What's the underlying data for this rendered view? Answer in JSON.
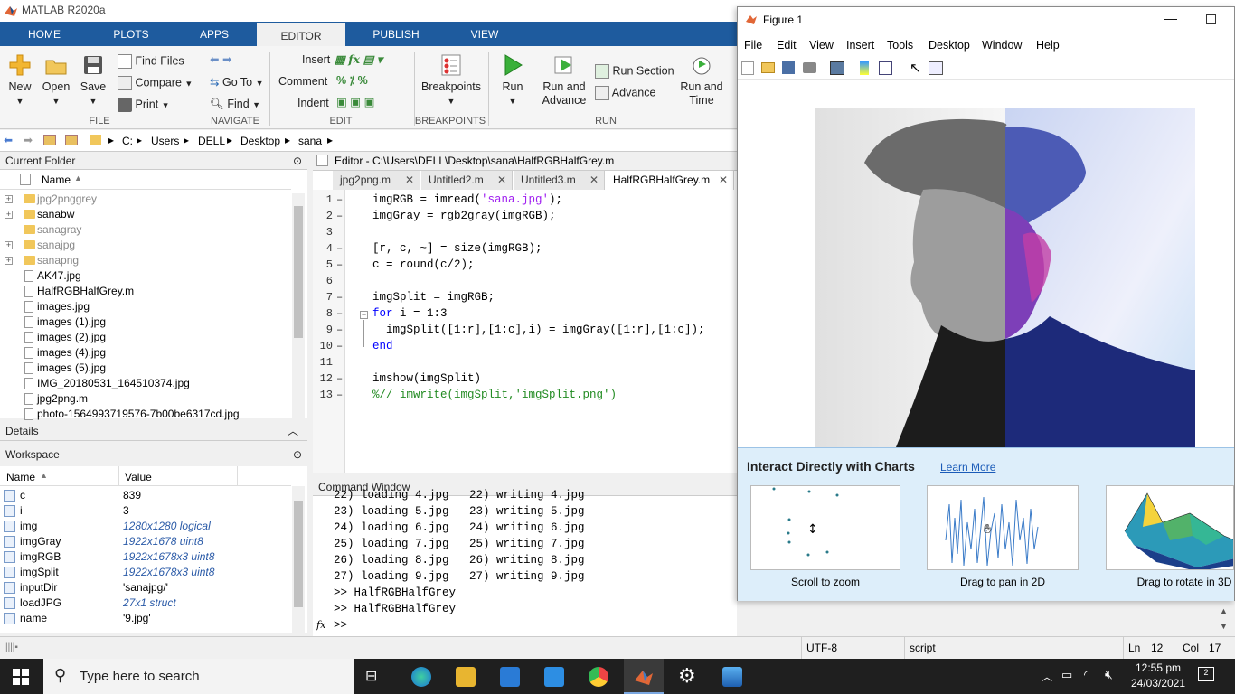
{
  "app": {
    "title": "MATLAB R2020a"
  },
  "tabs": [
    "HOME",
    "PLOTS",
    "APPS",
    "EDITOR",
    "PUBLISH",
    "VIEW"
  ],
  "ribbon": {
    "file": {
      "new": "New",
      "open": "Open",
      "save": "Save",
      "find_files": "Find Files",
      "compare": "Compare",
      "print": "Print",
      "group": "FILE"
    },
    "navigate": {
      "go_to": "Go To",
      "find": "Find",
      "group": "NAVIGATE"
    },
    "edit": {
      "insert": "Insert",
      "comment": "Comment",
      "indent": "Indent",
      "group": "EDIT"
    },
    "breakpoints": {
      "label": "Breakpoints",
      "group": "BREAKPOINTS"
    },
    "run": {
      "run": "Run",
      "run_advance_1": "Run and",
      "run_advance_2": "Advance",
      "run_section": "Run Section",
      "advance": "Advance",
      "run_time_1": "Run and",
      "run_time_2": "Time",
      "group": "RUN"
    }
  },
  "address": {
    "parts": [
      "C:",
      "Users",
      "DELL",
      "Desktop",
      "sana"
    ]
  },
  "current_folder": {
    "title": "Current Folder",
    "col_name": "Name",
    "items": [
      {
        "name": "jpg2pnggrey",
        "type": "folder",
        "dim": true,
        "plus": true
      },
      {
        "name": "sanabw",
        "type": "folder",
        "dim": false,
        "plus": true
      },
      {
        "name": "sanagray",
        "type": "folder",
        "dim": true,
        "plus": false
      },
      {
        "name": "sanajpg",
        "type": "folder",
        "dim": true,
        "plus": true
      },
      {
        "name": "sanapng",
        "type": "folder",
        "dim": true,
        "plus": true
      },
      {
        "name": "AK47.jpg",
        "type": "file"
      },
      {
        "name": "HalfRGBHalfGrey.m",
        "type": "file"
      },
      {
        "name": "images.jpg",
        "type": "file"
      },
      {
        "name": "images (1).jpg",
        "type": "file"
      },
      {
        "name": "images (2).jpg",
        "type": "file"
      },
      {
        "name": "images (4).jpg",
        "type": "file"
      },
      {
        "name": "images (5).jpg",
        "type": "file"
      },
      {
        "name": "IMG_20180531_164510374.jpg",
        "type": "file"
      },
      {
        "name": "jpg2png.m",
        "type": "file"
      },
      {
        "name": "photo-1564993719576-7b00be6317cd.jpg",
        "type": "file"
      }
    ]
  },
  "details": {
    "title": "Details"
  },
  "workspace": {
    "title": "Workspace",
    "col_name": "Name",
    "col_value": "Value",
    "rows": [
      {
        "name": "c",
        "value": "839",
        "italic": false
      },
      {
        "name": "i",
        "value": "3",
        "italic": false
      },
      {
        "name": "img",
        "value": "1280x1280 logical",
        "italic": true
      },
      {
        "name": "imgGray",
        "value": "1922x1678 uint8",
        "italic": true
      },
      {
        "name": "imgRGB",
        "value": "1922x1678x3 uint8",
        "italic": true
      },
      {
        "name": "imgSplit",
        "value": "1922x1678x3 uint8",
        "italic": true
      },
      {
        "name": "inputDir",
        "value": "'sanajpg/'",
        "italic": false
      },
      {
        "name": "loadJPG",
        "value": "27x1 struct",
        "italic": true
      },
      {
        "name": "name",
        "value": "'9.jpg'",
        "italic": false
      }
    ]
  },
  "editor": {
    "title": "Editor - C:\\Users\\DELL\\Desktop\\sana\\HalfRGBHalfGrey.m",
    "tabs": [
      "jpg2png.m",
      "Untitled2.m",
      "Untitled3.m",
      "HalfRGBHalfGrey.m"
    ],
    "lines": [
      "1",
      "2",
      "3",
      "4",
      "5",
      "6",
      "7",
      "8",
      "9",
      "10",
      "11",
      "12",
      "13"
    ]
  },
  "command_window": {
    "title": "Command Window",
    "lines": [
      "22) loading 4.jpg   22) writing 4.jpg",
      "23) loading 5.jpg   23) writing 5.jpg",
      "24) loading 6.jpg   24) writing 6.jpg",
      "25) loading 7.jpg   25) writing 7.jpg",
      "26) loading 8.jpg   26) writing 8.jpg",
      "27) loading 9.jpg   27) writing 9.jpg",
      ">> HalfRGBHalfGrey",
      ">> HalfRGBHalfGrey"
    ],
    "prompt": ">>",
    "fx": "fx"
  },
  "status": {
    "encoding": "UTF-8",
    "type": "script",
    "ln_label": "Ln",
    "ln": "12",
    "col_label": "Col",
    "col": "17"
  },
  "figure": {
    "title": "Figure 1",
    "menu": [
      "File",
      "Edit",
      "View",
      "Insert",
      "Tools",
      "Desktop",
      "Window",
      "Help"
    ],
    "tip_title": "Interact Directly with Charts",
    "learn_more": "Learn More",
    "cards": [
      "Scroll to zoom",
      "Drag to pan in 2D",
      "Drag to rotate in 3D"
    ]
  },
  "taskbar": {
    "search_placeholder": "Type here to search",
    "time": "12:55 pm",
    "date": "24/03/2021"
  }
}
